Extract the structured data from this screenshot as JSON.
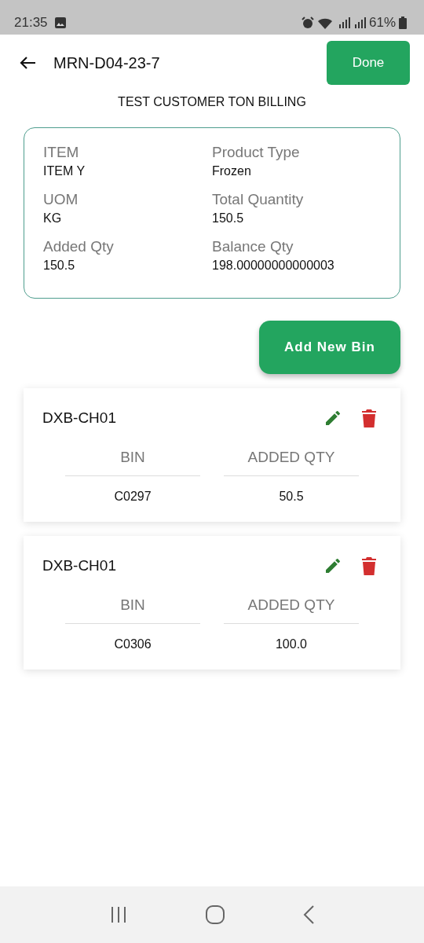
{
  "status_bar": {
    "time": "21:35",
    "battery": "61%"
  },
  "header": {
    "title": "MRN-D04-23-7",
    "done_button": "Done"
  },
  "customer": "TEST CUSTOMER TON BILLING",
  "summary": [
    {
      "label": "ITEM",
      "value": "ITEM Y"
    },
    {
      "label": "Product Type",
      "value": "Frozen"
    },
    {
      "label": "UOM",
      "value": "KG"
    },
    {
      "label": "Total Quantity",
      "value": "150.5"
    },
    {
      "label": "Added Qty",
      "value": "150.5"
    },
    {
      "label": "Balance Qty",
      "value": "198.00000000000003"
    }
  ],
  "add_button": "Add New Bin",
  "bins": [
    {
      "location": "DXB-CH01",
      "columns": [
        "BIN",
        "ADDED QTY"
      ],
      "values": [
        "C0297",
        "50.5"
      ]
    },
    {
      "location": "DXB-CH01",
      "columns": [
        "BIN",
        "ADDED QTY"
      ],
      "values": [
        "C0306",
        "100.0"
      ]
    }
  ]
}
